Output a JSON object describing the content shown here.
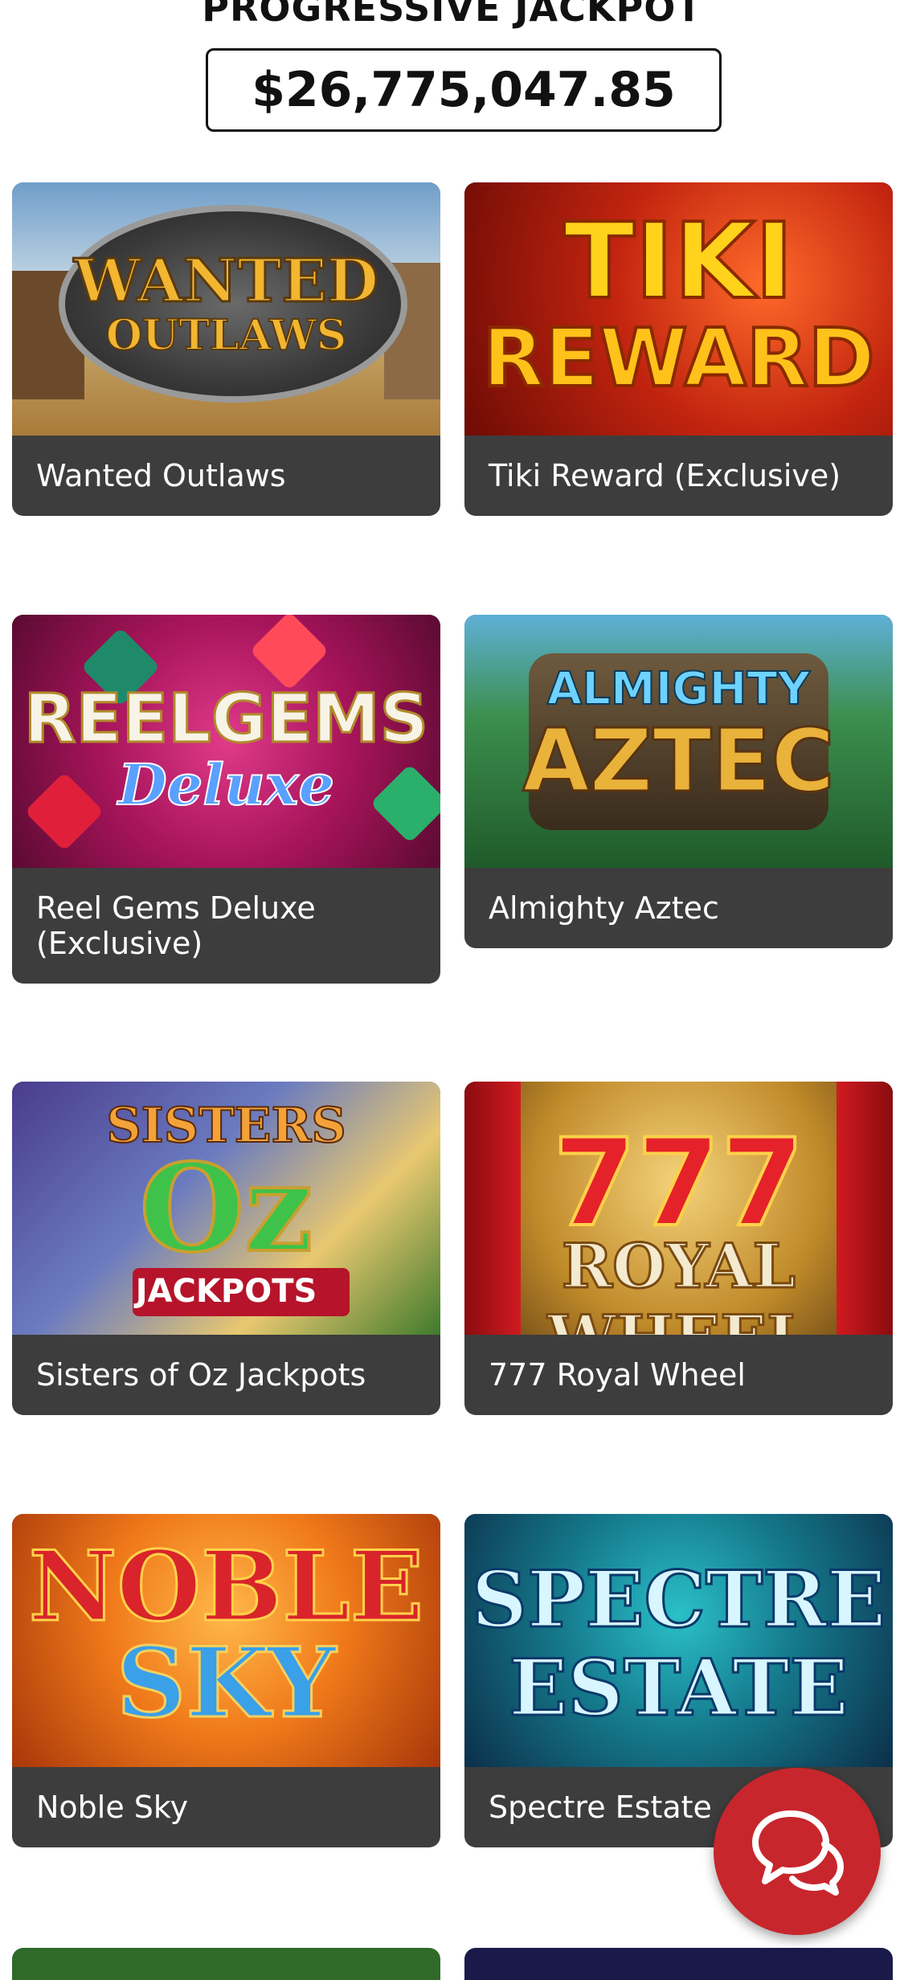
{
  "jackpot": {
    "title": "PROGRESSIVE JACKPOT",
    "amount": "$26,775,047.85"
  },
  "games": [
    {
      "name": "Wanted Outlaws",
      "logo_line1": "WANTED",
      "logo_line2": "OUTLAWS"
    },
    {
      "name": "Tiki Reward (Exclusive)",
      "logo_line1": "TIKI",
      "logo_line2": "REWARD"
    },
    {
      "name": "Reel Gems Deluxe (Exclusive)",
      "logo_line1": "REELGEMS",
      "logo_line2": "Deluxe"
    },
    {
      "name": "Almighty Aztec",
      "logo_line1": "ALMIGHTY",
      "logo_line2": "AZTEC"
    },
    {
      "name": "Sisters of Oz Jackpots",
      "logo_line1": "SISTERS",
      "logo_line2": "Oz",
      "logo_line3": "JACKPOTS"
    },
    {
      "name": "777 Royal Wheel",
      "logo_line1": "777",
      "logo_line2": "ROYAL WHEEL"
    },
    {
      "name": "Noble Sky",
      "logo_line1": "NOBLE",
      "logo_line2": "SKY"
    },
    {
      "name": "Spectre Estate",
      "logo_line1": "SPECTRE",
      "logo_line2": "ESTATE"
    }
  ],
  "chat_button": {
    "icon": "chat-bubbles-icon",
    "color": "#c7262c"
  },
  "colors": {
    "card_background": "#3d3d3d",
    "page_background": "#ffffff"
  }
}
